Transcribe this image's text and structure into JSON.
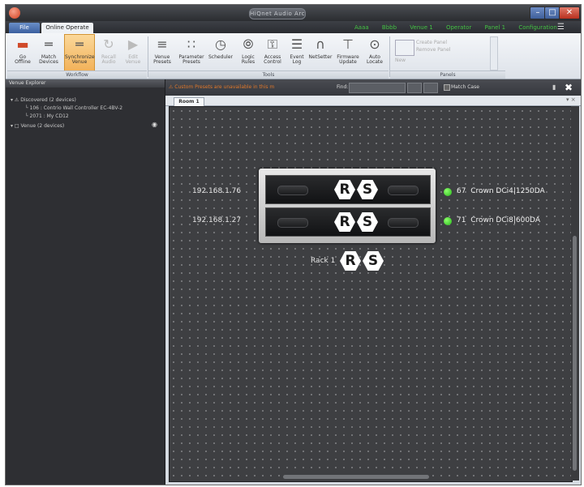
{
  "window": {
    "title": "HiQnet Audio Architect",
    "min_glyph": "–",
    "max_glyph": "□",
    "close_glyph": "✕"
  },
  "tabs": [
    {
      "label": "File"
    },
    {
      "label": "Online Operate"
    }
  ],
  "quick_menu": [
    "Aaaa",
    "Bbbb",
    "Venue 1",
    "Operator",
    "Panel 1",
    "Configuration"
  ],
  "ribbon": {
    "workflow_buttons": [
      {
        "line1": "Go",
        "line2": "Offline",
        "icon": "go-offline-icon",
        "glyph": "▬"
      },
      {
        "line1": "Match",
        "line2": "Devices",
        "icon": "match-devices-icon",
        "glyph": "═"
      },
      {
        "line1": "Synchronize",
        "line2": "Venue",
        "icon": "synchronize-icon",
        "glyph": "═"
      },
      {
        "line1": "Recall",
        "line2": "Audio",
        "icon": "recall-audio-icon",
        "glyph": "↻"
      },
      {
        "line1": "Edit",
        "line2": "Venue",
        "icon": "edit-venue-icon",
        "glyph": "▶"
      }
    ],
    "tools_buttons": [
      {
        "line1": "Venue",
        "line2": "Presets",
        "icon": "venue-presets-icon",
        "glyph": "≡"
      },
      {
        "line1": "Parameter",
        "line2": "Presets",
        "icon": "parameter-presets-icon",
        "glyph": "∷"
      },
      {
        "line1": "Scheduler",
        "line2": "",
        "icon": "scheduler-icon",
        "glyph": "◷"
      },
      {
        "line1": "Logic",
        "line2": "Rules",
        "icon": "logic-rules-icon",
        "glyph": "⦾"
      },
      {
        "line1": "Access",
        "line2": "Control",
        "icon": "access-control-icon",
        "glyph": "⚿"
      },
      {
        "line1": "Event",
        "line2": "Log",
        "icon": "event-log-icon",
        "glyph": "☰"
      },
      {
        "line1": "NetSetter",
        "line2": "",
        "icon": "netsetter-icon",
        "glyph": "∩"
      },
      {
        "line1": "Firmware",
        "line2": "Update",
        "icon": "firmware-update-icon",
        "glyph": "⊤"
      },
      {
        "line1": "Auto",
        "line2": "Locate",
        "icon": "auto-locate-icon",
        "glyph": "⊙"
      }
    ],
    "panels_new": "New",
    "panels_item1": "Create Panel",
    "panels_item2": "Remove Panel",
    "group_workflow": "Workflow",
    "group_tools": "Tools",
    "group_panels": "Panels"
  },
  "venue_explorer": {
    "title": "Venue Explorer",
    "tree": [
      {
        "label": "▾ ⚠ Discovered (2 devices)"
      },
      {
        "label": "└ 106 : Contrio Wall Controller EC-4BV-2"
      },
      {
        "label": "└ 2071 : My CD12"
      },
      {
        "label": "▾ □ Venue (2 devices)"
      }
    ]
  },
  "toolbar": {
    "warning": "⚠ Custom Presets are unavailable in this m",
    "find_label": "Find:",
    "match_case": "Match Case",
    "pin_glyph": "▮",
    "expand_glyph": "✖"
  },
  "room_tab": {
    "label": "Room 1",
    "close_glyph": "▾ ×"
  },
  "rack": {
    "label": "Rack 1",
    "units": [
      {
        "ip": "192.168.1.76",
        "id": "67",
        "model": "Crown DCi4|1250DA"
      },
      {
        "ip": "192.168.1.27",
        "id": "71",
        "model": "Crown DCi8|600DA"
      }
    ],
    "logo_r": "R",
    "logo_s": "S"
  },
  "colors": {
    "status_online": "#27b81a",
    "warning_text": "#e0782a",
    "active_button": "#f2b25a"
  }
}
